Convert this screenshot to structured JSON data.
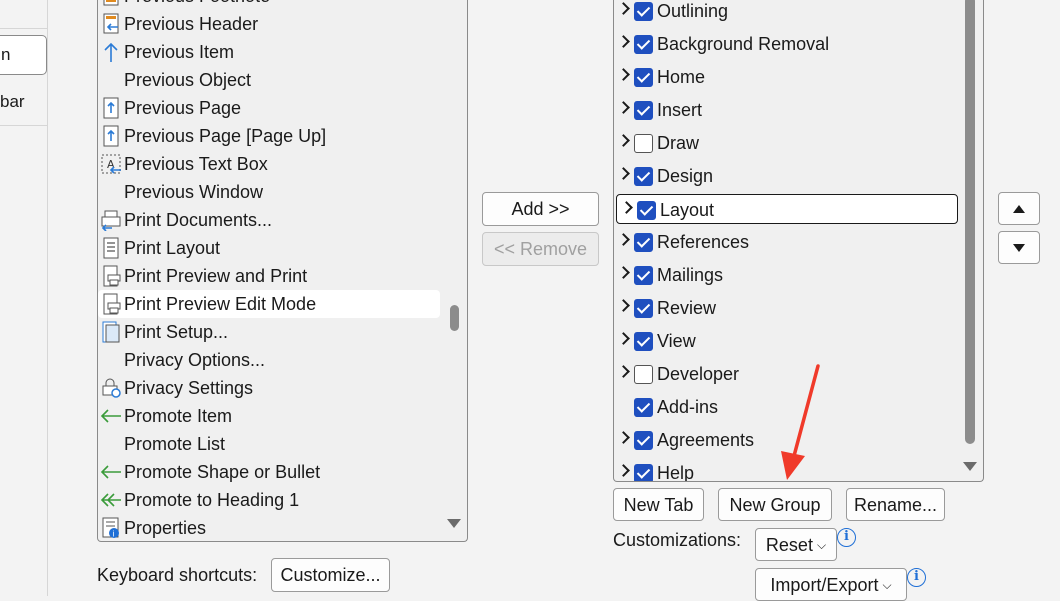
{
  "left_nav": {
    "selected_label": "n",
    "item_label": "bar"
  },
  "commands": {
    "items": [
      {
        "label": "Previous Footnote",
        "icon": "footnote-icon"
      },
      {
        "label": "Previous Header",
        "icon": "previous-header-icon"
      },
      {
        "label": "Previous Item",
        "icon": "arrow-up-icon"
      },
      {
        "label": "Previous Object",
        "icon": ""
      },
      {
        "label": "Previous Page",
        "icon": "page-up-icon"
      },
      {
        "label": "Previous Page [Page Up]",
        "icon": "page-up-icon"
      },
      {
        "label": "Previous Text Box",
        "icon": "text-box-icon"
      },
      {
        "label": "Previous Window",
        "icon": ""
      },
      {
        "label": "Print Documents...",
        "icon": "print-documents-icon"
      },
      {
        "label": "Print Layout",
        "icon": "print-layout-icon"
      },
      {
        "label": "Print Preview and Print",
        "icon": "print-preview-icon"
      },
      {
        "label": "Print Preview Edit Mode",
        "icon": "print-preview-icon"
      },
      {
        "label": "Print Setup...",
        "icon": "print-setup-icon"
      },
      {
        "label": "Privacy Options...",
        "icon": ""
      },
      {
        "label": "Privacy Settings",
        "icon": "privacy-settings-icon"
      },
      {
        "label": "Promote Item",
        "icon": "arrow-left-icon"
      },
      {
        "label": "Promote List",
        "icon": ""
      },
      {
        "label": "Promote Shape or Bullet",
        "icon": "arrow-left-icon"
      },
      {
        "label": "Promote to Heading 1",
        "icon": "double-arrow-left-icon"
      },
      {
        "label": "Properties",
        "icon": "properties-icon"
      }
    ],
    "selected": "Print Preview Edit Mode"
  },
  "buttons": {
    "add": "Add >>",
    "remove": "<< Remove",
    "new_tab": "New Tab",
    "new_group": "New Group",
    "rename": "Rename...",
    "reset": "Reset",
    "import_export": "Import/Export",
    "customize": "Customize..."
  },
  "ribbon_tabs": [
    {
      "label": "Outlining",
      "checked": true,
      "expandable": true
    },
    {
      "label": "Background Removal",
      "checked": true,
      "expandable": true
    },
    {
      "label": "Home",
      "checked": true,
      "expandable": true
    },
    {
      "label": "Insert",
      "checked": true,
      "expandable": true
    },
    {
      "label": "Draw",
      "checked": false,
      "expandable": true
    },
    {
      "label": "Design",
      "checked": true,
      "expandable": true
    },
    {
      "label": "Layout",
      "checked": true,
      "expandable": true,
      "focused": true
    },
    {
      "label": "References",
      "checked": true,
      "expandable": true
    },
    {
      "label": "Mailings",
      "checked": true,
      "expandable": true
    },
    {
      "label": "Review",
      "checked": true,
      "expandable": true
    },
    {
      "label": "View",
      "checked": true,
      "expandable": true
    },
    {
      "label": "Developer",
      "checked": false,
      "expandable": true
    },
    {
      "label": "Add-ins",
      "checked": true,
      "expandable": false
    },
    {
      "label": "Agreements",
      "checked": true,
      "expandable": true
    },
    {
      "label": "Help",
      "checked": true,
      "expandable": true
    }
  ],
  "labels": {
    "keyboard_shortcuts": "Keyboard shortcuts:",
    "customizations": "Customizations:"
  },
  "colors": {
    "checkbox": "#1f4fbf",
    "annotation_arrow": "#f03a2a",
    "info": "#1f6fd6"
  }
}
